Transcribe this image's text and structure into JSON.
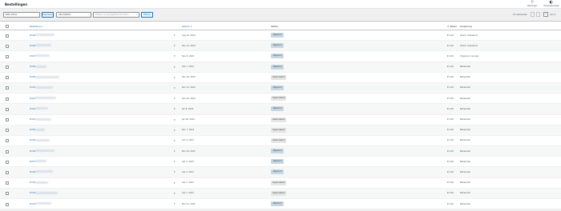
{
  "header": {
    "title": "Bestellingen",
    "items": [
      {
        "icon": "flag-icon",
        "label": "Meldingen"
      },
      {
        "icon": "half-circle-icon",
        "label": "Hulp/rapportage"
      }
    ]
  },
  "toolbar": {
    "bulk_select": "Bulk acties",
    "apply_label": "Toepassen",
    "date_select": "Alle datums",
    "customer_placeholder": "Filteren op geregistreerde klant...",
    "filter_label": "Filteren",
    "items_count": "21 elementen",
    "first_page": "«",
    "prev_page": "‹",
    "current_page": "1",
    "total_pages": "van 2"
  },
  "table": {
    "columns": {
      "order": "Bestelling",
      "date": "Datum",
      "status": "Status",
      "total": "Totaal",
      "origin": "Oorsprong"
    },
    "rows": [
      {
        "id": "#349",
        "date": "Aug 19, 2024",
        "status": "Afgerond",
        "status_kind": "a",
        "total": "€ 0,00",
        "origin": "Direct: Onbekend"
      },
      {
        "id": "#348",
        "date": "Nov 13, 2024",
        "status": "Afgerond",
        "status_kind": "a",
        "total": "€ 0,00",
        "origin": "Direct: Onbekend"
      },
      {
        "id": "#347",
        "date": "Nov 8, 2024",
        "status": "Afgerond",
        "status_kind": "a",
        "total": "€ 0,00",
        "origin": "Organisch: Google"
      },
      {
        "id": "#346",
        "date": "Feb 7, 2024",
        "status": "Afgerond",
        "status_kind": "a",
        "total": "€ 0,00",
        "origin": "Beheerder"
      },
      {
        "id": "#345",
        "date": "Dec 18, 2024",
        "status": "Geannuleerd",
        "status_kind": "b",
        "total": "€ 0,00",
        "origin": "Beheerder"
      },
      {
        "id": "#344",
        "date": "Nov 12, 2024",
        "status": "Afgerond",
        "status_kind": "a",
        "total": "€ 0,00",
        "origin": "Beheerder"
      },
      {
        "id": "#343",
        "date": "Nov 20, 2024",
        "status": "Geannuleerd",
        "status_kind": "b",
        "total": "€ 0,00",
        "origin": "Beheerder"
      },
      {
        "id": "#342",
        "date": "Jan 8, 2024",
        "status": "Afgerond",
        "status_kind": "a",
        "total": "€ 0,00",
        "origin": "Beheerder"
      },
      {
        "id": "#341",
        "date": "Jan 28, 2024",
        "status": "Geannuleerd",
        "status_kind": "b",
        "total": "€ 0,00",
        "origin": "Beheerder"
      },
      {
        "id": "#340",
        "date": "Dec 7, 2023",
        "status": "Geannuleerd",
        "status_kind": "b",
        "total": "€ 0,00",
        "origin": "Beheerder"
      },
      {
        "id": "#339",
        "date": "Oct 4, 2023",
        "status": "Geannuleerd",
        "status_kind": "b",
        "total": "€ 0,00",
        "origin": "Beheerder"
      },
      {
        "id": "#338",
        "date": "Mar 18, 2023",
        "status": "Afgerond",
        "status_kind": "a",
        "total": "€ 0,00",
        "origin": "Beheerder"
      },
      {
        "id": "#337",
        "date": "Apr 3, 2023",
        "status": "Afgerond",
        "status_kind": "a",
        "total": "€ 0,00",
        "origin": "Beheerder"
      },
      {
        "id": "#336",
        "date": "Apr 2, 2023",
        "status": "Afgerond",
        "status_kind": "a",
        "total": "€ 0,00",
        "origin": "Beheerder"
      },
      {
        "id": "#335",
        "date": "Apr 1, 2023",
        "status": "Geannuleerd",
        "status_kind": "b",
        "total": "€ 0,00",
        "origin": "Beheerder"
      },
      {
        "id": "#334",
        "date": "Apr 1, 2023",
        "status": "Geannuleerd",
        "status_kind": "b",
        "total": "€ 0,00",
        "origin": "Beheerder"
      },
      {
        "id": "#333",
        "date": "Mar 11, 2023",
        "status": "Afgerond",
        "status_kind": "a",
        "total": "€ 0,00",
        "origin": "Beheerder"
      }
    ]
  }
}
